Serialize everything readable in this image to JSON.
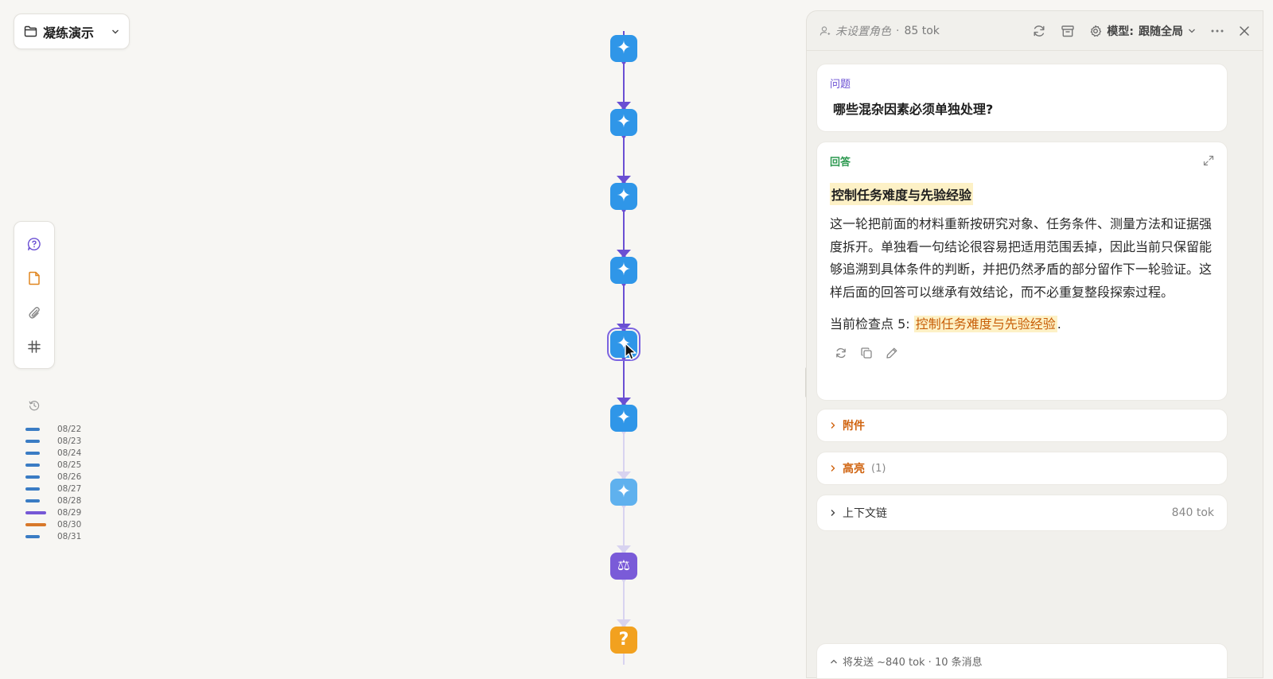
{
  "project": {
    "name": "凝练演示",
    "folder_icon": "folder-icon",
    "dropdown_icon": "chevron-down-icon"
  },
  "left_toolbar": {
    "items": [
      {
        "name": "question",
        "icon": "question-bubble-icon",
        "color": "#6a4fd3"
      },
      {
        "name": "note",
        "icon": "note-icon",
        "color": "#e0851e"
      },
      {
        "name": "attachment",
        "icon": "paperclip-icon",
        "color": "#888888"
      },
      {
        "name": "hash",
        "icon": "hash-icon",
        "color": "#555555"
      }
    ]
  },
  "history": {
    "icon": "history-icon",
    "dates": [
      "08/22",
      "08/23",
      "08/24",
      "08/25",
      "08/26",
      "08/27",
      "08/28",
      "08/29",
      "08/30",
      "08/31"
    ],
    "bar_colors": [
      "#3a7cc4",
      "#3a7cc4",
      "#3a7cc4",
      "#3a7cc4",
      "#3a7cc4",
      "#3a7cc4",
      "#3a7cc4",
      "#7658d6",
      "#d8782a",
      "#3a7cc4"
    ]
  },
  "timeline": {
    "nodes": [
      {
        "type": "sparkle",
        "glyph": "✦",
        "state": "normal"
      },
      {
        "type": "sparkle",
        "glyph": "✦",
        "state": "normal"
      },
      {
        "type": "sparkle",
        "glyph": "✦",
        "state": "normal"
      },
      {
        "type": "sparkle",
        "glyph": "✦",
        "state": "normal"
      },
      {
        "type": "sparkle",
        "glyph": "✦",
        "state": "selected"
      },
      {
        "type": "sparkle",
        "glyph": "✦",
        "state": "normal"
      },
      {
        "type": "sparkle",
        "glyph": "✦",
        "state": "dim"
      },
      {
        "type": "judge",
        "glyph": "⚖",
        "state": "dim"
      },
      {
        "type": "question",
        "glyph": "?",
        "state": "dim"
      }
    ],
    "colors": {
      "blue": "#2f96e8",
      "light": "#5fb1ee",
      "purple": "#7a5bd8",
      "orange": "#f2a11f",
      "edge_active": "#6a4fd3",
      "edge_dim": "#d8d3f0"
    }
  },
  "panel": {
    "role_text": "未设置角色",
    "role_sep": "·",
    "role_tok": "85 tok",
    "model_label": "模型:",
    "model_value": "跟随全局",
    "question": {
      "label": "问题",
      "text": "哪些混杂因素必须单独处理?"
    },
    "answer": {
      "label": "回答",
      "title": "控制任务难度与先验经验",
      "body": "这一轮把前面的材料重新按研究对象、任务条件、测量方法和证据强度拆开。单独看一句结论很容易把适用范围丢掉，因此当前只保留能够追溯到具体条件的判断，并把仍然矛盾的部分留作下一轮验证。这样后面的回答可以继承有效结论，而不必重复整段探索过程。",
      "check_prefix": "当前检查点 5: ",
      "check_highlight": "控制任务难度与先验经验",
      "check_suffix": "."
    },
    "attachments_label": "附件",
    "highlights_label": "高亮",
    "highlights_count": "(1)",
    "context_label": "上下文链",
    "context_tok": "840 tok",
    "send_text": "将发送 ~840 tok · 10 条消息"
  }
}
